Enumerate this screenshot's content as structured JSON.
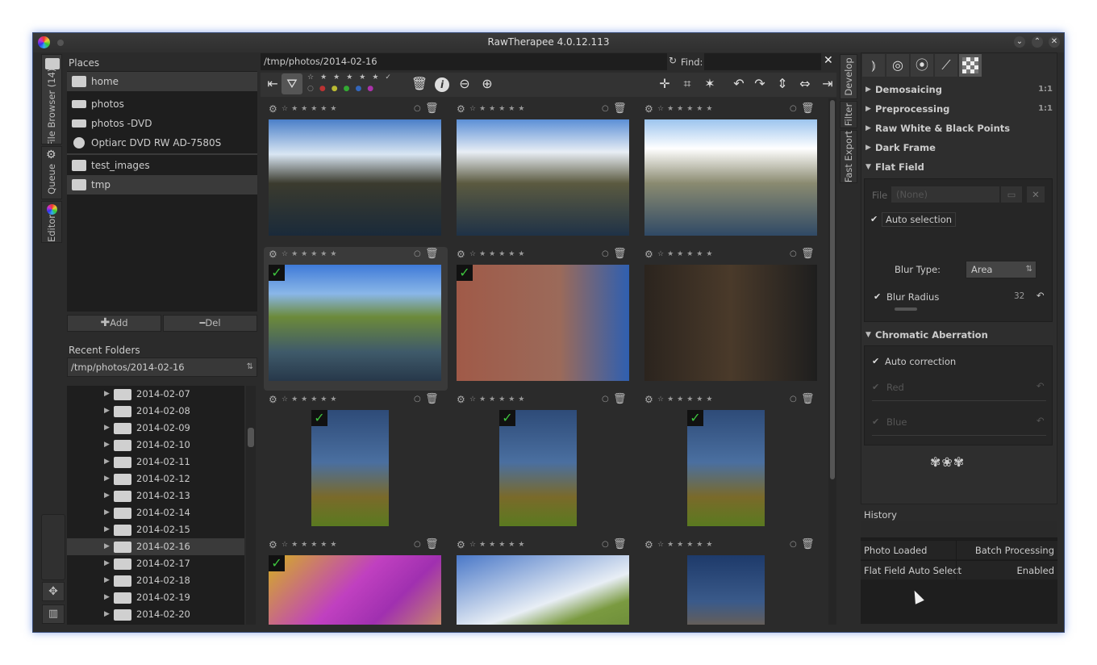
{
  "window": {
    "title": "RawTherapee 4.0.12.113"
  },
  "side_tabs": {
    "file_browser": "File Browser (14)",
    "queue": "Queue",
    "editor": "Editor"
  },
  "places": {
    "header": "Places",
    "items": [
      {
        "label": "home",
        "icon": "home-icon"
      },
      {
        "label": "photos",
        "icon": "drive-icon"
      },
      {
        "label": "photos -DVD",
        "icon": "drive-icon"
      },
      {
        "label": "Optiarc DVD RW AD-7580S",
        "icon": "disc-icon"
      },
      {
        "label": "test_images",
        "icon": "folder-icon"
      },
      {
        "label": "tmp",
        "icon": "folder-icon"
      }
    ],
    "add": "Add",
    "del": "Del"
  },
  "recent": {
    "header": "Recent Folders",
    "value": "/tmp/photos/2014-02-16"
  },
  "tree": [
    "2014-02-07",
    "2014-02-08",
    "2014-02-09",
    "2014-02-10",
    "2014-02-11",
    "2014-02-12",
    "2014-02-13",
    "2014-02-14",
    "2014-02-15",
    "2014-02-16",
    "2014-02-17",
    "2014-02-18",
    "2014-02-19",
    "2014-02-20"
  ],
  "browser": {
    "path": "/tmp/photos/2014-02-16",
    "find_label": "Find:",
    "find_value": ""
  },
  "thumbs": [
    {
      "checked": false,
      "scene": "canal1"
    },
    {
      "checked": false,
      "scene": "canal2"
    },
    {
      "checked": false,
      "scene": "canal3"
    },
    {
      "checked": true,
      "scene": "street"
    },
    {
      "checked": true,
      "scene": "horse"
    },
    {
      "checked": false,
      "scene": "colorchart"
    },
    {
      "checked": true,
      "scene": "tree"
    },
    {
      "checked": true,
      "scene": "tree"
    },
    {
      "checked": true,
      "scene": "tree"
    },
    {
      "checked": true,
      "scene": "orchid"
    },
    {
      "checked": false,
      "scene": "hill"
    },
    {
      "checked": false,
      "scene": "tower"
    }
  ],
  "right_tabs": {
    "develop": "Develop",
    "filter": "Filter",
    "fast_export": "Fast Export"
  },
  "sections": {
    "demosaicing": "Demosaicing",
    "preprocessing": "Preprocessing",
    "raw_wb": "Raw White & Black Points",
    "dark_frame": "Dark Frame",
    "flat_field": "Flat Field",
    "chromatic": "Chromatic Aberration",
    "ratio": "1:1"
  },
  "flatfield": {
    "file_label": "File",
    "file_value": "(None)",
    "auto_selection": "Auto selection",
    "blur_type_label": "Blur Type:",
    "blur_type_value": "Area",
    "blur_radius_label": "Blur Radius",
    "blur_radius_value": "32"
  },
  "chroma": {
    "auto_correction": "Auto correction",
    "red": "Red",
    "blue": "Blue"
  },
  "history": {
    "header": "History",
    "rows": [
      {
        "a": "Photo Loaded",
        "b": "Batch Processing"
      },
      {
        "a": "Flat Field Auto Select",
        "b": "Enabled"
      }
    ]
  }
}
